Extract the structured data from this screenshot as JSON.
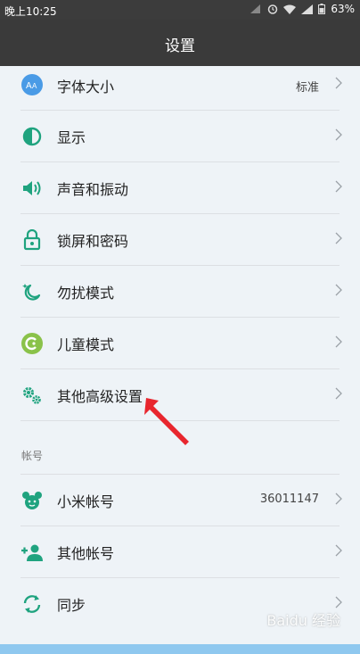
{
  "status_bar": {
    "time": "晚上10:25",
    "battery": "63%"
  },
  "header": {
    "title": "设置"
  },
  "rows_top": [
    {
      "label": "字体大小",
      "value": "标准",
      "icon": "font-size-icon"
    },
    {
      "label": "显示",
      "value": "",
      "icon": "display-icon"
    },
    {
      "label": "声音和振动",
      "value": "",
      "icon": "sound-icon"
    },
    {
      "label": "锁屏和密码",
      "value": "",
      "icon": "lock-icon"
    },
    {
      "label": "勿扰模式",
      "value": "",
      "icon": "moon-icon"
    },
    {
      "label": "儿童模式",
      "value": "",
      "icon": "kids-icon"
    },
    {
      "label": "其他高级设置",
      "value": "",
      "icon": "gears-icon"
    }
  ],
  "section": {
    "title": "帐号"
  },
  "rows_account": [
    {
      "label": "小米帐号",
      "value": "36011147",
      "icon": "mi-account-icon"
    },
    {
      "label": "其他帐号",
      "value": "",
      "icon": "add-person-icon"
    },
    {
      "label": "同步",
      "value": "",
      "icon": "sync-icon"
    }
  ],
  "colors": {
    "accent": "#1fa37f",
    "header": "#3a3a3a",
    "background": "#eef3f7"
  },
  "watermark": "Baidu 经验"
}
